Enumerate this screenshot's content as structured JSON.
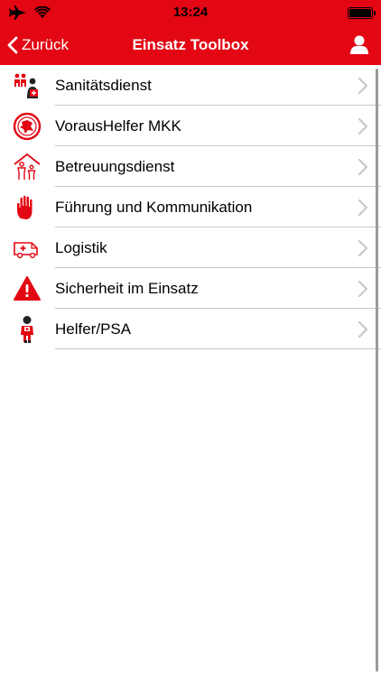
{
  "status_bar": {
    "time": "13:24",
    "icons": [
      "airplane-icon",
      "wifi-icon",
      "battery-icon"
    ]
  },
  "nav": {
    "back_label": "Zurück",
    "title": "Einsatz Toolbox",
    "user_icon": "user-icon"
  },
  "colors": {
    "brand_red": "#e30613",
    "chevron": "#c7c7cc",
    "separator": "#c8c7cc"
  },
  "items": [
    {
      "label": "Sanitätsdienst",
      "icon": "medics-icon"
    },
    {
      "label": "VorausHelfer MKK",
      "icon": "vorashelfer-emblem-icon"
    },
    {
      "label": "Betreuungsdienst",
      "icon": "care-shelter-icon"
    },
    {
      "label": "Führung und Kommunikation",
      "icon": "stop-hand-icon"
    },
    {
      "label": "Logistik",
      "icon": "ambulance-icon"
    },
    {
      "label": "Sicherheit im Einsatz",
      "icon": "warning-triangle-icon"
    },
    {
      "label": "Helfer/PSA",
      "icon": "helper-person-icon"
    }
  ]
}
